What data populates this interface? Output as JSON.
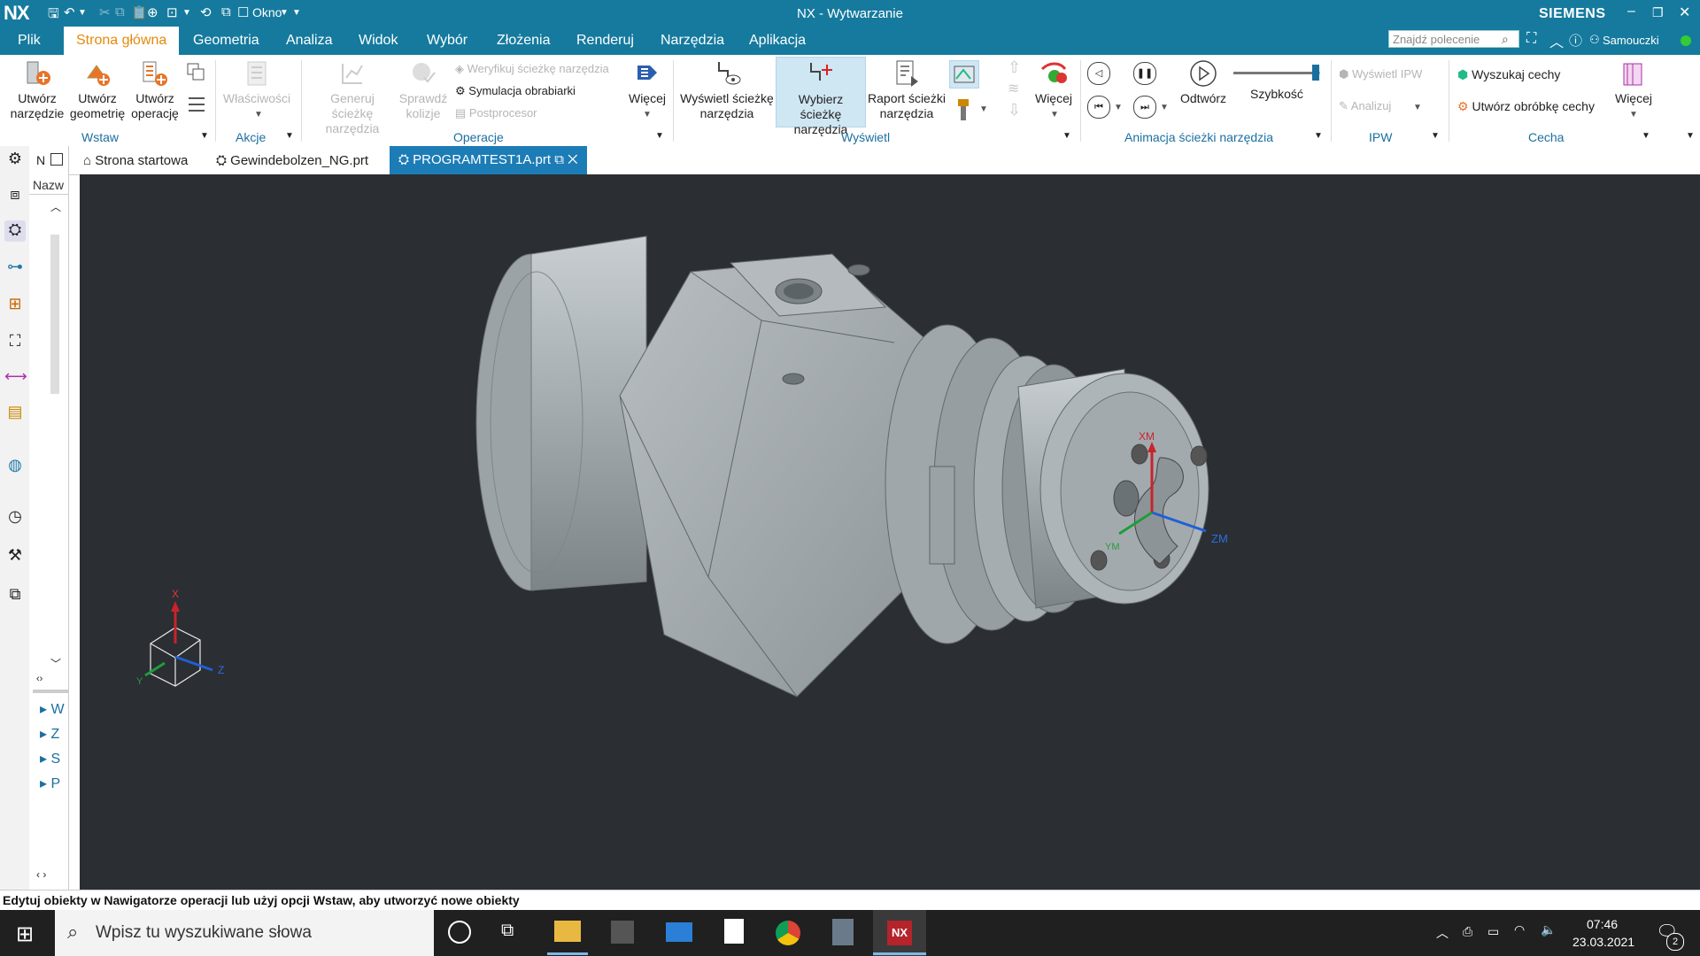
{
  "app": {
    "logo": "NX",
    "title": "NX - Wytwarzanie",
    "brand": "SIEMENS",
    "window_menu": "Okno"
  },
  "menu": {
    "items": [
      "Plik",
      "Strona główna",
      "Geometria",
      "Analiza",
      "Widok",
      "Wybór",
      "Złożenia",
      "Renderuj",
      "Narzędzia",
      "Aplikacja"
    ],
    "active": "Strona główna",
    "search_placeholder": "Znajdź polecenie",
    "tutorials": "Samouczki"
  },
  "ribbon": {
    "wstaw": {
      "group": "Wstaw",
      "create_tool": "Utwórz narzędzie",
      "create_geometry": "Utwórz geometrię",
      "create_operation": "Utwórz operację"
    },
    "akcje": {
      "group": "Akcje",
      "properties": "Właściwości"
    },
    "operacje": {
      "group": "Operacje",
      "generate": "Generuj ścieżkę narzędzia",
      "check": "Sprawdź kolizje",
      "verify": "Weryfikuj ścieżkę narzędzia",
      "simulate": "Symulacja obrabiarki",
      "postprocessor": "Postprocesor",
      "more": "Więcej"
    },
    "wyswietl": {
      "group": "Wyświetl",
      "show_path": "Wyświetl ścieżkę narzędzia",
      "select_path": "Wybierz ścieżkę narzędzia",
      "report": "Raport ścieżki narzędzia",
      "more": "Więcej"
    },
    "animacja": {
      "group": "Animacja ścieżki narzędzia",
      "play": "Odtwórz",
      "speed": "Szybkość",
      "speed_level": 0.95
    },
    "ipw": {
      "group": "IPW",
      "show_ipw": "Wyświetl IPW",
      "analyze": "Analizuj"
    },
    "cecha": {
      "group": "Cecha",
      "find": "Wyszukaj cechy",
      "create": "Utwórz obróbkę cechy",
      "more": "Więcej"
    }
  },
  "navigator": {
    "header": "Nazw",
    "short_label": "N",
    "items": [
      "W",
      "Z",
      "S",
      "P"
    ]
  },
  "tabs": [
    {
      "label": "Strona startowa"
    },
    {
      "label": "Gewindebolzen_NG.prt"
    },
    {
      "label": "PROGRAMTEST1A.prt"
    }
  ],
  "viewport": {
    "triad": {
      "x": "X",
      "y": "Y",
      "z": "Z"
    },
    "wcs": {
      "xm": "XM",
      "ym": "YM",
      "zm": "ZM"
    }
  },
  "status_text": "Edytuj obiekty w Nawigatorze operacji lub użyj opcji Wstaw, aby utworzyć nowe obiekty",
  "taskbar": {
    "search_placeholder": "Wpisz tu wyszukiwane słowa",
    "time": "07:46",
    "date": "23.03.2021",
    "notifications": "2",
    "nx_app": "NX"
  },
  "colors": {
    "accent": "#157a9e",
    "active_menu": "#e58a0b",
    "tab_active": "#1c7cb6",
    "viewport_bg": "#2b2e33",
    "part": "#a8afb3"
  }
}
